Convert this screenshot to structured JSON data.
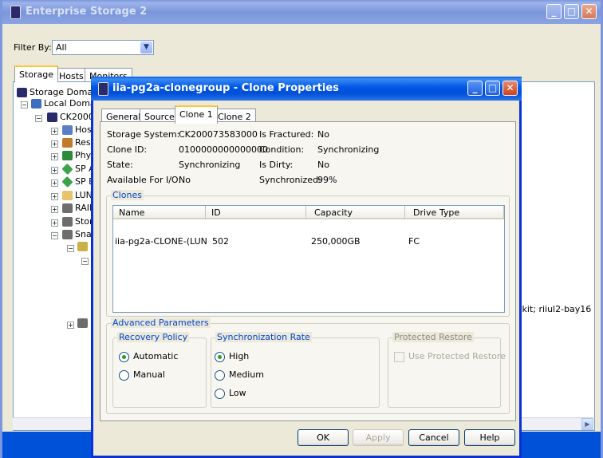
{
  "main_window": {
    "title": "Enterprise Storage 2",
    "filter_label": "Filter By:",
    "filter_value": "All",
    "tabs": [
      "Storage",
      "Hosts",
      "Monitors"
    ],
    "tree": {
      "root": "Storage Domains",
      "local_domain": "Local Domain",
      "system": "CK20007",
      "children": [
        "Host",
        "Rese",
        "Phys",
        "SP A",
        "SP B",
        "LUN",
        "RAID",
        "Stor",
        "Snap"
      ],
      "right_text": ".kit; riiul2-bay16"
    }
  },
  "dialog": {
    "title": "iia-pg2a-clonegroup - Clone Properties",
    "tabs": [
      "General",
      "Source",
      "Clone 1",
      "Clone 2"
    ],
    "props": {
      "storage_system_label": "Storage System:",
      "storage_system": "CK200073583000",
      "clone_id_label": "Clone ID:",
      "clone_id": "0100000000000000",
      "state_label": "State:",
      "state": "Synchronizing",
      "available_label": "Available For I/O:",
      "available": "No",
      "fractured_label": "Is Fractured:",
      "fractured": "No",
      "condition_label": "Condition:",
      "condition": "Synchronizing",
      "dirty_label": "Is Dirty:",
      "dirty": "No",
      "synchronized_label": "Synchronized:",
      "synchronized": "99%"
    },
    "clones": {
      "legend": "Clones",
      "columns": [
        "Name",
        "ID",
        "Capacity",
        "Drive Type"
      ],
      "rows": [
        {
          "name": "iia-pg2a-CLONE-(LUN ...",
          "id": "502",
          "capacity": "250,000GB",
          "drive_type": "FC"
        }
      ]
    },
    "advanced": {
      "legend": "Advanced Parameters",
      "recovery_policy": {
        "legend": "Recovery Policy",
        "options": [
          "Automatic",
          "Manual"
        ],
        "selected": "Automatic"
      },
      "sync_rate": {
        "legend": "Synchronization Rate",
        "options": [
          "High",
          "Medium",
          "Low"
        ],
        "selected": "High"
      },
      "protected_restore": {
        "legend": "Protected Restore",
        "checkbox_label": "Use Protected Restore",
        "checked": false
      }
    },
    "buttons": {
      "ok": "OK",
      "apply": "Apply",
      "cancel": "Cancel",
      "help": "Help"
    }
  },
  "colors": {
    "title_active": "#0055e5",
    "title_inactive": "#7b96db",
    "group_legend": "#0046d5",
    "window_bg": "#ece9d8"
  }
}
